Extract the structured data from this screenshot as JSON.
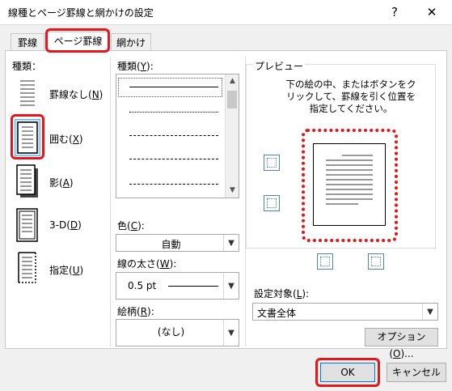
{
  "window": {
    "title": "線種とページ罫線と網かけの設定",
    "help_label": "?",
    "close_label": "✕"
  },
  "tabs": [
    {
      "label": "罫線"
    },
    {
      "label": "ページ罫線"
    },
    {
      "label": "網かけ"
    }
  ],
  "setting": {
    "heading": "種類：",
    "items": [
      {
        "label_main": "罫線なし(",
        "key": "N",
        "label_end": ")"
      },
      {
        "label_main": "囲む(",
        "key": "X",
        "label_end": ")"
      },
      {
        "label_main": "影(",
        "key": "A",
        "label_end": ")"
      },
      {
        "label_main": "3-D(",
        "key": "D",
        "label_end": ")"
      },
      {
        "label_main": "指定(",
        "key": "U",
        "label_end": ")"
      }
    ]
  },
  "style": {
    "heading_main": "種類(",
    "heading_key": "Y",
    "heading_end": "):"
  },
  "color": {
    "label_main": "色(",
    "key": "C",
    "label_end": "):",
    "value": "自動"
  },
  "width": {
    "label_main": "線の太さ(",
    "key": "W",
    "label_end": "):",
    "value": "0.5 pt"
  },
  "art": {
    "label_main": "絵柄(",
    "key": "R",
    "label_end": "):",
    "value": "(なし)"
  },
  "preview": {
    "heading": "プレビュー",
    "instruction": "下の絵の中、またはボタンをクリックして、罫線を引く位置を指定してください。"
  },
  "apply_to": {
    "label_main": "設定対象(",
    "key": "L",
    "label_end": "):",
    "value": "文書全体"
  },
  "buttons": {
    "options_main": "オプション(",
    "options_key": "O",
    "options_end": ")...",
    "ok": "OK",
    "cancel": "キャンセル"
  },
  "colors": {
    "highlight": "#e3171c",
    "dotted_border": "#e3171c",
    "selected_item": "#cce4f7",
    "preview_button_border": "#4a86c6"
  }
}
